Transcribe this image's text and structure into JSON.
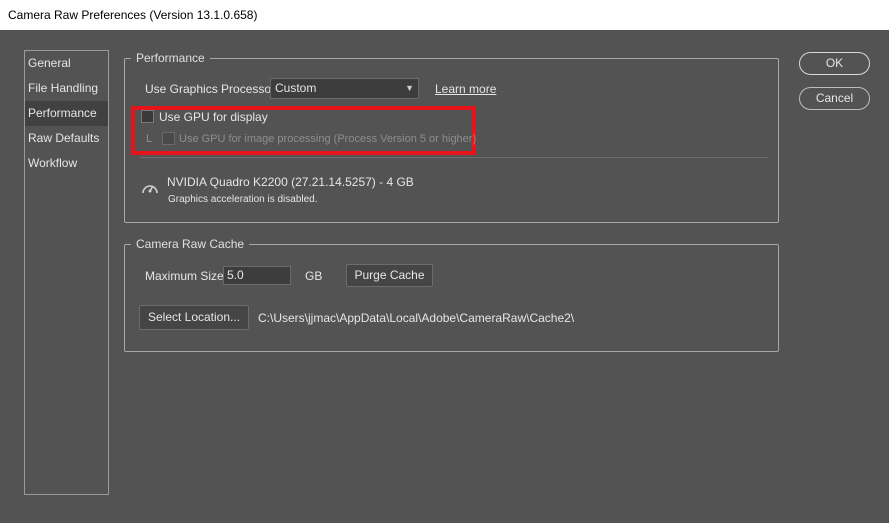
{
  "window": {
    "title": "Camera Raw Preferences  (Version 13.1.0.658)"
  },
  "nav": {
    "items": [
      {
        "label": "General"
      },
      {
        "label": "File Handling"
      },
      {
        "label": "Performance"
      },
      {
        "label": "Raw Defaults"
      },
      {
        "label": "Workflow"
      }
    ],
    "selected": "Performance"
  },
  "performance": {
    "title": "Performance",
    "gpu_label": "Use Graphics Processor:",
    "gpu_value": "Custom",
    "learn_more": "Learn more",
    "use_gpu_display": {
      "label": "Use GPU for display",
      "checked": false
    },
    "sub_marker": "L",
    "use_gpu_processing": {
      "label": "Use GPU for image processing (Process Version 5 or higher)",
      "checked": false,
      "disabled": true
    },
    "gpu_name": "NVIDIA Quadro K2200 (27.21.14.5257) - 4 GB",
    "gpu_status": "Graphics acceleration is disabled."
  },
  "cache": {
    "title": "Camera Raw Cache",
    "max_size_label": "Maximum Size:",
    "max_size_value": "5.0",
    "unit": "GB",
    "purge_button": "Purge Cache",
    "select_location_button": "Select Location...",
    "path": "C:\\Users\\jjmac\\AppData\\Local\\Adobe\\CameraRaw\\Cache2\\"
  },
  "actions": {
    "ok": "OK",
    "cancel": "Cancel"
  },
  "colors": {
    "background": "#535353",
    "highlight": "#e8141c"
  },
  "icons": {
    "gpu": "speedometer-icon",
    "dropdown": "chevron-down-icon"
  }
}
